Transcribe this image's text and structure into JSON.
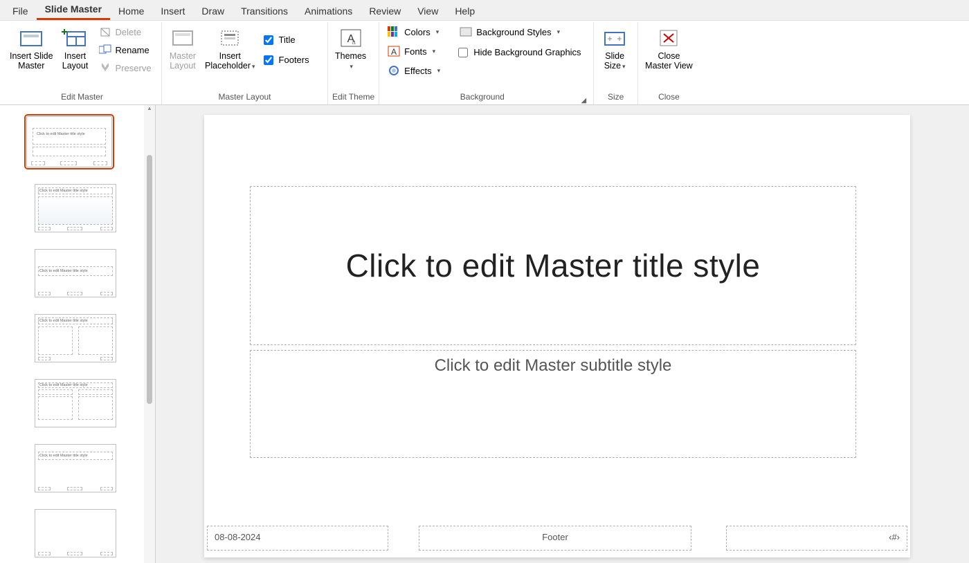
{
  "tabs": [
    "File",
    "Slide Master",
    "Home",
    "Insert",
    "Draw",
    "Transitions",
    "Animations",
    "Review",
    "View",
    "Help"
  ],
  "active_tab": "Slide Master",
  "ribbon": {
    "edit_master": {
      "insert_slide_master": "Insert Slide\nMaster",
      "insert_layout": "Insert\nLayout",
      "delete": "Delete",
      "rename": "Rename",
      "preserve": "Preserve",
      "label": "Edit Master"
    },
    "master_layout": {
      "master_layout": "Master\nLayout",
      "insert_placeholder": "Insert\nPlaceholder",
      "title": "Title",
      "footers": "Footers",
      "label": "Master Layout"
    },
    "edit_theme": {
      "themes": "Themes",
      "label": "Edit Theme"
    },
    "background": {
      "colors": "Colors",
      "fonts": "Fonts",
      "effects": "Effects",
      "bg_styles": "Background Styles",
      "hide_bg": "Hide Background Graphics",
      "label": "Background"
    },
    "size": {
      "slide_size": "Slide\nSize",
      "label": "Size"
    },
    "close": {
      "close": "Close\nMaster View",
      "label": "Close"
    }
  },
  "slide": {
    "title": "Click to edit Master title style",
    "subtitle": "Click to edit Master subtitle style",
    "date": "08-08-2024",
    "footer": "Footer",
    "num": "‹#›"
  },
  "thumbs": {
    "master_title": "Click to edit Master title style",
    "layout_title": "Click to edit Master title style"
  }
}
